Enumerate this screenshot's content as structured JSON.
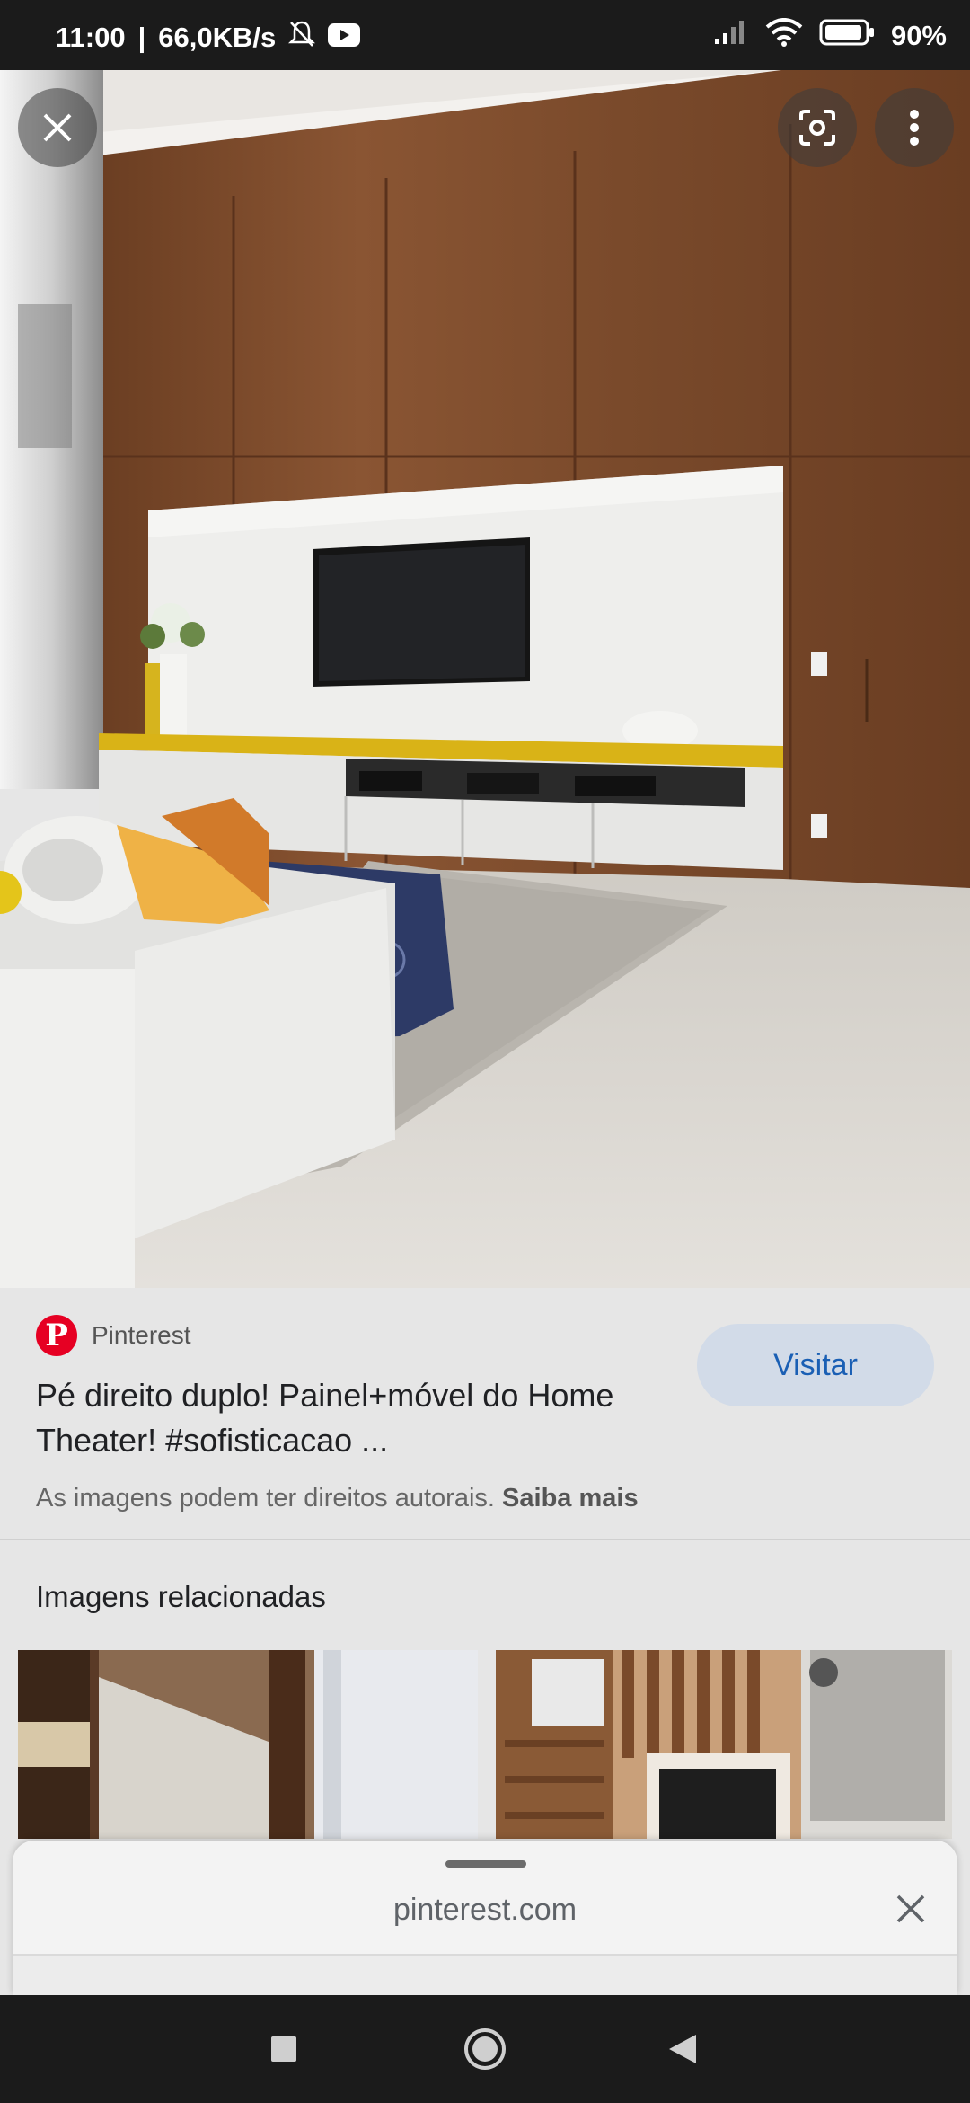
{
  "status_bar": {
    "time": "11:00",
    "separator": "|",
    "speed": "66,0KB/s",
    "battery": "90%",
    "icons": [
      "bell-off-icon",
      "youtube-icon",
      "signal-icon",
      "wifi-icon",
      "battery-icon"
    ]
  },
  "viewer": {
    "close_icon": "close-icon",
    "lens_icon": "lens-icon",
    "more_icon": "more-vert-icon"
  },
  "result": {
    "source": "Pinterest",
    "title": "Pé direito duplo! Painel+móvel do Home Theater! #sofisticacao ...",
    "visit_label": "Visitar",
    "copyright_text": "As imagens podem ter direitos autorais.",
    "copyright_link": "Saiba mais"
  },
  "related": {
    "title": "Imagens relacionadas"
  },
  "sheet": {
    "url": "pinterest.com"
  },
  "nav": {
    "icons": [
      "recents-icon",
      "home-icon",
      "back-icon"
    ]
  },
  "colors": {
    "accent": "#1a5fb4",
    "pinterest_red": "#e60023",
    "visit_bg": "#d2dbe8"
  }
}
